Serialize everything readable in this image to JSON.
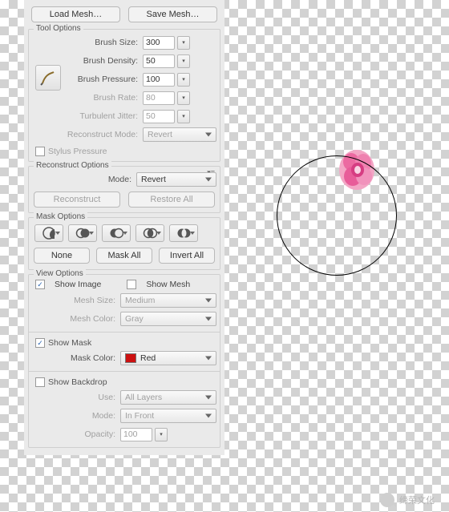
{
  "top": {
    "load": "Load Mesh…",
    "save": "Save Mesh…"
  },
  "toolOptions": {
    "title": "Tool Options",
    "brushSizeLabel": "Brush Size:",
    "brushSize": "300",
    "brushDensityLabel": "Brush Density:",
    "brushDensity": "50",
    "brushPressureLabel": "Brush Pressure:",
    "brushPressure": "100",
    "brushRateLabel": "Brush Rate:",
    "brushRate": "80",
    "turbulentJitterLabel": "Turbulent Jitter:",
    "turbulentJitter": "50",
    "reconstructModeLabel": "Reconstruct Mode:",
    "reconstructMode": "Revert",
    "stylus": "Stylus Pressure"
  },
  "reconstruct": {
    "title": "Reconstruct Options",
    "modeLabel": "Mode:",
    "mode": "Revert",
    "reconstructBtn": "Reconstruct",
    "restoreBtn": "Restore All"
  },
  "mask": {
    "title": "Mask Options",
    "none": "None",
    "maskAll": "Mask All",
    "invertAll": "Invert All"
  },
  "view": {
    "title": "View Options",
    "showImage": "Show Image",
    "showMesh": "Show Mesh",
    "meshSizeLabel": "Mesh Size:",
    "meshSize": "Medium",
    "meshColorLabel": "Mesh Color:",
    "meshColor": "Gray",
    "showMask": "Show Mask",
    "maskColorLabel": "Mask Color:",
    "maskColor": "Red",
    "showBackdrop": "Show Backdrop",
    "useLabel": "Use:",
    "use": "All Layers",
    "modeLabel": "Mode:",
    "mode": "In Front",
    "opacityLabel": "Opacity:",
    "opacity": "100"
  },
  "watermark": "缔荣文化"
}
